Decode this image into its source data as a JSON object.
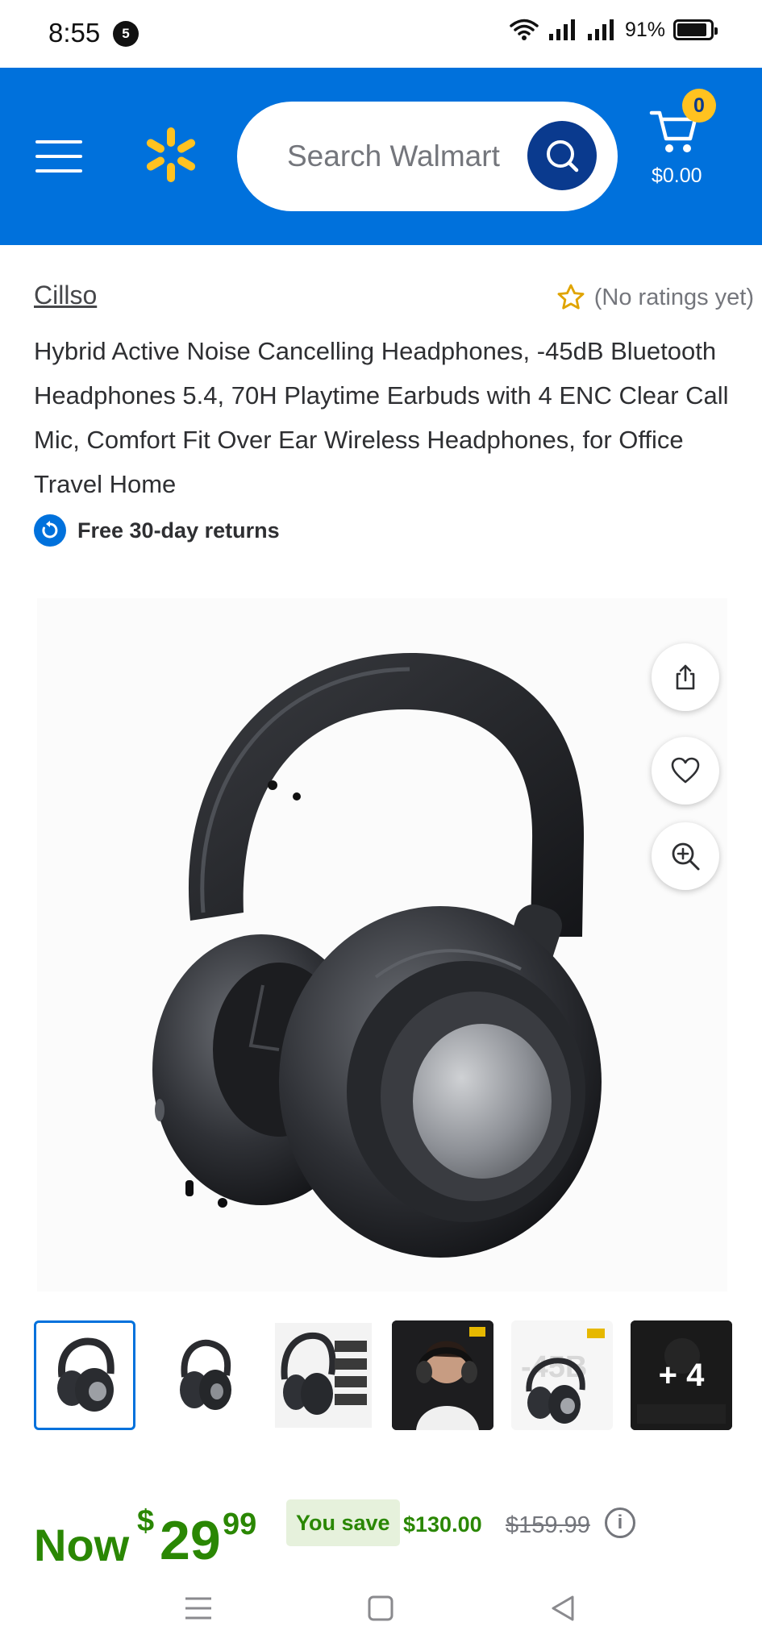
{
  "status_bar": {
    "time": "8:55",
    "notification_count": "5",
    "battery": "91%",
    "battery_level": 0.91
  },
  "header": {
    "search_placeholder": "Search Walmart",
    "cart_count": "0",
    "cart_total": "$0.00",
    "brand_color": "#0071dc",
    "spark_color": "#ffc220"
  },
  "product": {
    "brand": "Cillso",
    "rating_text": "(No ratings yet)",
    "title": "Hybrid Active Noise Cancelling Headphones, -45dB Bluetooth Headphones 5.4, 70H Playtime Earbuds with 4 ENC Clear Call Mic, Comfort Fit Over Ear Wireless Headphones, for Office Travel Home",
    "returns": "Free 30-day returns"
  },
  "gallery": {
    "more_label": "+ 4",
    "thumb_count": 6
  },
  "price": {
    "now_label": "Now",
    "currency": "$",
    "whole": "29",
    "cents": "99",
    "you_save_label": "You save",
    "save_amount": "$130.00",
    "was_price": "$159.99",
    "info": "i"
  },
  "icons": {
    "menu": "hamburger-icon",
    "logo": "spark-icon",
    "search": "search-icon",
    "cart": "cart-icon",
    "rating": "star-outline-icon",
    "returns": "returns-icon",
    "share": "share-icon",
    "favorite": "heart-icon",
    "zoom": "zoom-in-icon"
  }
}
